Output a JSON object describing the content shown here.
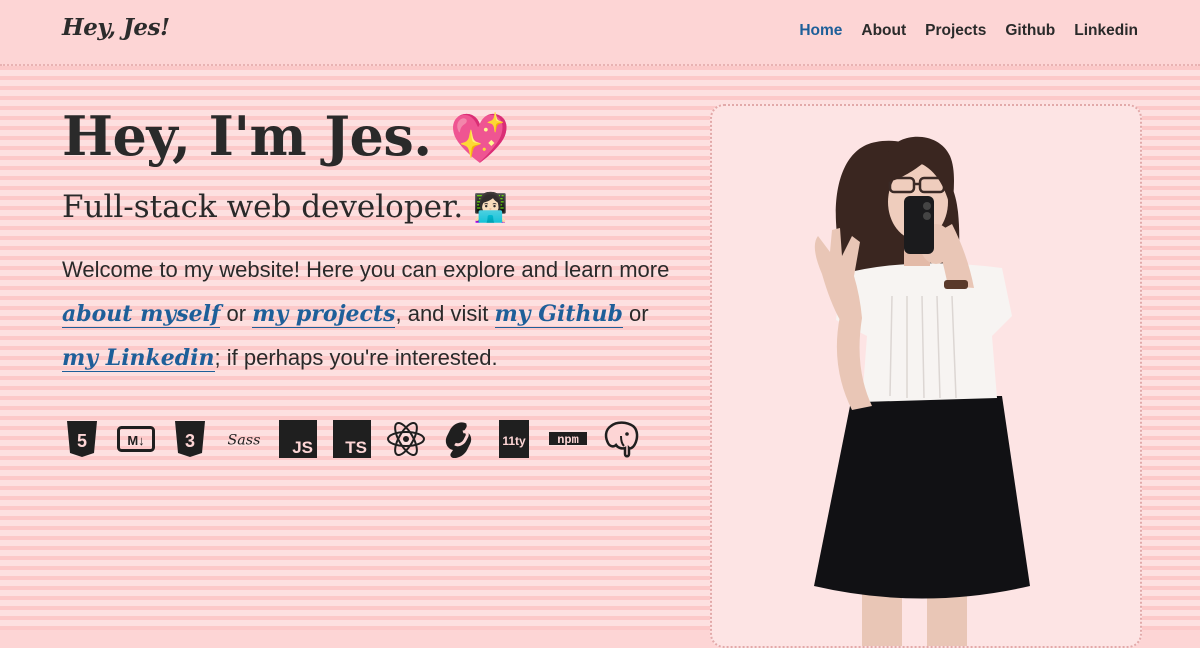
{
  "header": {
    "logo": "Hey, Jes!",
    "nav": [
      {
        "label": "Home",
        "active": true
      },
      {
        "label": "About"
      },
      {
        "label": "Projects"
      },
      {
        "label": "Github"
      },
      {
        "label": "Linkedin"
      }
    ]
  },
  "hero": {
    "title": "Hey, I'm Jes.",
    "title_emoji": "💖",
    "subtitle": "Full-stack web developer.",
    "subtitle_emoji": "👩🏻‍💻",
    "intro": {
      "t1": "Welcome to my website! Here you can explore and learn more ",
      "link_about": "about myself",
      "t2": " or ",
      "link_projects": "my projects",
      "t3": ", and visit ",
      "link_github": "my Github",
      "t4": " or ",
      "link_linkedin": "my Linkedin",
      "t5": "; if perhaps you're interested."
    }
  },
  "tech_icons": [
    {
      "name": "html5-icon",
      "text": "5"
    },
    {
      "name": "markdown-icon",
      "text": "M↓"
    },
    {
      "name": "css3-icon",
      "text": "3"
    },
    {
      "name": "sass-icon",
      "text": "Sass"
    },
    {
      "name": "javascript-icon",
      "text": "JS"
    },
    {
      "name": "typescript-icon",
      "text": "TS"
    },
    {
      "name": "react-icon",
      "text": ""
    },
    {
      "name": "svelte-icon",
      "text": ""
    },
    {
      "name": "eleventy-icon",
      "text": "11ty"
    },
    {
      "name": "npm-icon",
      "text": "npm"
    },
    {
      "name": "postgresql-icon",
      "text": ""
    }
  ],
  "colors": {
    "background": "#fdd5d5",
    "accent": "#1e5f99",
    "text": "#2a2a2a"
  }
}
